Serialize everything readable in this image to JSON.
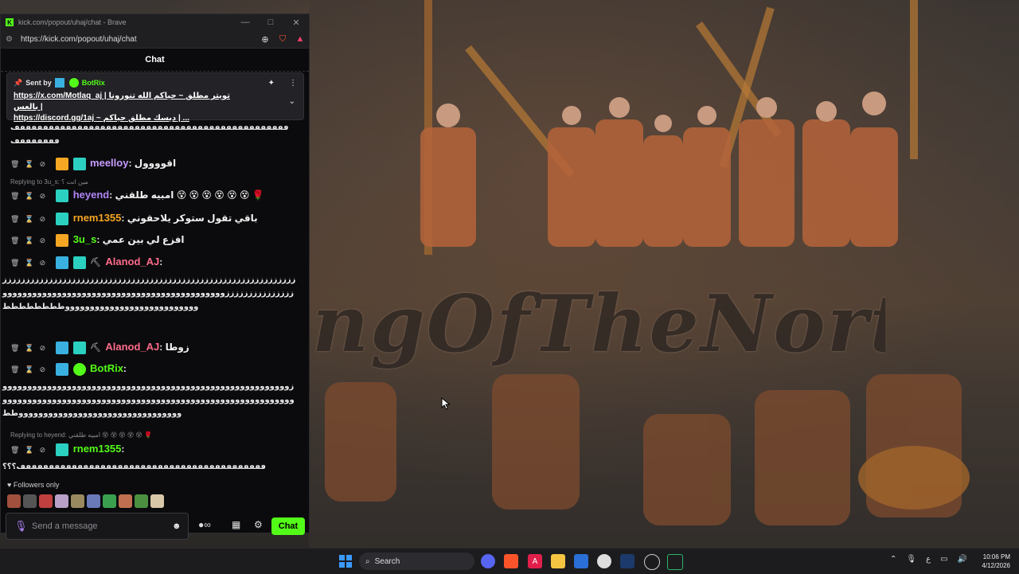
{
  "browser": {
    "window_title": "kick.com/popout/uhaj/chat - Brave",
    "url": "https://kick.com/popout/uhaj/chat",
    "controls": {
      "minimize": "—",
      "maximize": "□",
      "close": "✕"
    }
  },
  "chat": {
    "header": "Chat",
    "pinned": {
      "sent_by_label": "Sent by",
      "sender": "BotRix",
      "line1": "https://x.com/Motlaq_aj | تويتر مطلق ~ حياكم الله تنورونا بالعس |",
      "line2": "https://discord.gg/1aj ~ ديسك مطلق حياكم | ..."
    },
    "messages": [
      {
        "id": "m0",
        "text": "ڡڡڡڡڡڡڡڡڡڡڡڡڡڡڡڡڡڡڡڡڡڡڡڡڡڡڡڡڡڡڡڡڡڡڡڡڡڡڡڡڡڡڡڡڡڡڡڡ",
        "text2": "ڡڡڡڡڡڡڡڡ"
      },
      {
        "id": "m1",
        "username": "meelloy",
        "text": "اقوووول",
        "color": "#c89bff"
      },
      {
        "id": "m2",
        "reply": "Replying to 3u_s: مين انت ؟",
        "username": "heyend",
        "text": "امبيه طلقني 😵 😵 😵 😵 😵 😵 🌹",
        "color": "#b084f5"
      },
      {
        "id": "m3",
        "username": "rnem1355",
        "text": "باقي تقول ستوكر يلاحقوني",
        "color": "#f5a623"
      },
      {
        "id": "m4",
        "username": "3u_s",
        "text": "افزع لي بين عمي",
        "color": "#53fc18"
      },
      {
        "id": "m5",
        "username": "Alanod_AJ",
        "text": "زززززززززززززززززززززززززززززززززززززززززززززززززززززززززززززززززززززززززززززززووووووووووووووووووووووووووووووووووووووووووووووووووووووووووووووووووووووووطططططططط",
        "color": "#ff6b8b"
      },
      {
        "id": "m6",
        "username": "Alanod_AJ",
        "text": "زوطا",
        "color": "#ff6b8b"
      },
      {
        "id": "m7",
        "username": "BotRix",
        "text": "زووووووووووووووووووووووووووووووووووووووووووووووووووووووووووووووووووووووووووووووووووووووووووووووووووووووووووووووووووووووووووووووووووووووووووووووووووووووطط",
        "color": "#53fc18"
      },
      {
        "id": "m8",
        "reply": "Replying to heyend: امبيه طلقني 😵 😵 😵 😵 😵 🌹",
        "username": "rnem1355",
        "text": "ڡڡڡڡڡڡڡڡڡڡڡڡڡڡڡڡڡڡڡڡڡڡڡڡڡڡڡڡڡڡڡڡڡڡڡڡڡڡڡڡڡڡڡ؟؟؟",
        "color": "#53fc18"
      }
    ],
    "followers_only": "Followers only",
    "composer_placeholder": "Send a message",
    "chat_button": "Chat"
  },
  "taskbar": {
    "search_label": "Search",
    "time": "10:06 PM",
    "date": "4/12/2026",
    "language": "ع"
  }
}
